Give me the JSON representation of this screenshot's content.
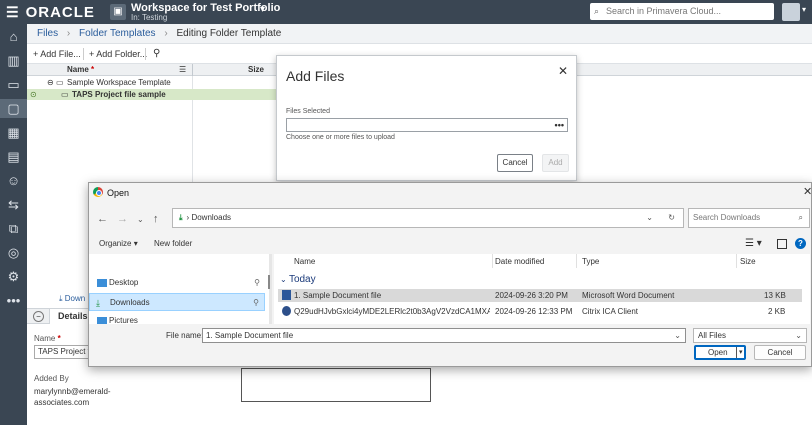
{
  "topbar": {
    "logo": "ORACLE",
    "workspace_title": "Workspace for Test Portfolio",
    "workspace_sub": "In: Testing",
    "search_placeholder": "Search in Primavera Cloud..."
  },
  "breadcrumb": {
    "items": [
      "Files",
      "Folder Templates",
      "Editing Folder Template"
    ]
  },
  "toolbar": {
    "add_file": "+ Add File...",
    "add_folder": "+ Add Folder..."
  },
  "grid": {
    "col_name": "Name",
    "col_name_required": "*",
    "col_size": "Size",
    "rows": [
      {
        "label": "Sample Workspace Template"
      },
      {
        "label": "TAPS Project file sample"
      }
    ]
  },
  "lower": {
    "download": "Down",
    "details_tab": "Details",
    "name_label": "Name",
    "name_value": "TAPS Project file",
    "added_by_label": "Added By",
    "added_by_value": "marylynnb@emerald-associates.com"
  },
  "add_files": {
    "title": "Add Files",
    "files_selected_label": "Files Selected",
    "hint": "Choose one or more files to upload",
    "cancel": "Cancel",
    "add": "Add"
  },
  "open_dialog": {
    "title": "Open",
    "path": "Downloads",
    "search_placeholder": "Search Downloads",
    "organize": "Organize",
    "new_folder": "New folder",
    "nav": [
      {
        "label": "Desktop"
      },
      {
        "label": "Downloads"
      },
      {
        "label": "Pictures"
      }
    ],
    "columns": {
      "name": "Name",
      "date": "Date modified",
      "type": "Type",
      "size": "Size"
    },
    "group": "Today",
    "files": [
      {
        "name": "1. Sample Document file",
        "date": "2024-09-26 3:20 PM",
        "type": "Microsoft Word Document",
        "size": "13 KB"
      },
      {
        "name": "Q29udHJvbGxlci4yMDE2LERlc2t0b3AgV2VzdCA1MXAgJF...",
        "date": "2024-09-26 12:33 PM",
        "type": "Citrix ICA Client",
        "size": "2 KB"
      }
    ],
    "file_name_label": "File name:",
    "file_name_value": "1. Sample Document file",
    "filter": "All Files",
    "open": "Open",
    "cancel": "Cancel"
  }
}
